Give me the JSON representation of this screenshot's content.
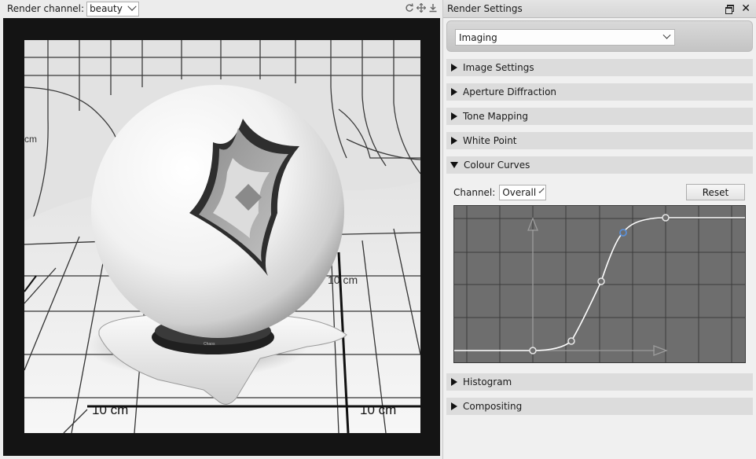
{
  "render_toolbar": {
    "channel_label": "Render channel:",
    "channel_value": "beauty",
    "icons": [
      "refresh-icon",
      "fit-icon",
      "download-icon"
    ]
  },
  "render_image": {
    "scale_labels": [
      "10 cm",
      "10 cm",
      "10 cm",
      "cm"
    ],
    "base_logo_text": "Chaos"
  },
  "settings": {
    "title": "Render Settings",
    "mode": "Imaging",
    "sections": {
      "image_settings": "Image Settings",
      "aperture": "Aperture Diffraction",
      "tone_mapping": "Tone Mapping",
      "white_point": "White Point",
      "colour_curves": "Colour Curves",
      "histogram": "Histogram",
      "compositing": "Compositing"
    },
    "channel_label": "Channel:",
    "channel_value": "Overall",
    "reset_label": "Reset"
  },
  "colors": {
    "curve_bg": "#6e6e6e",
    "selected_point": "#5b8fd6",
    "curve_line": "#ffffff"
  }
}
